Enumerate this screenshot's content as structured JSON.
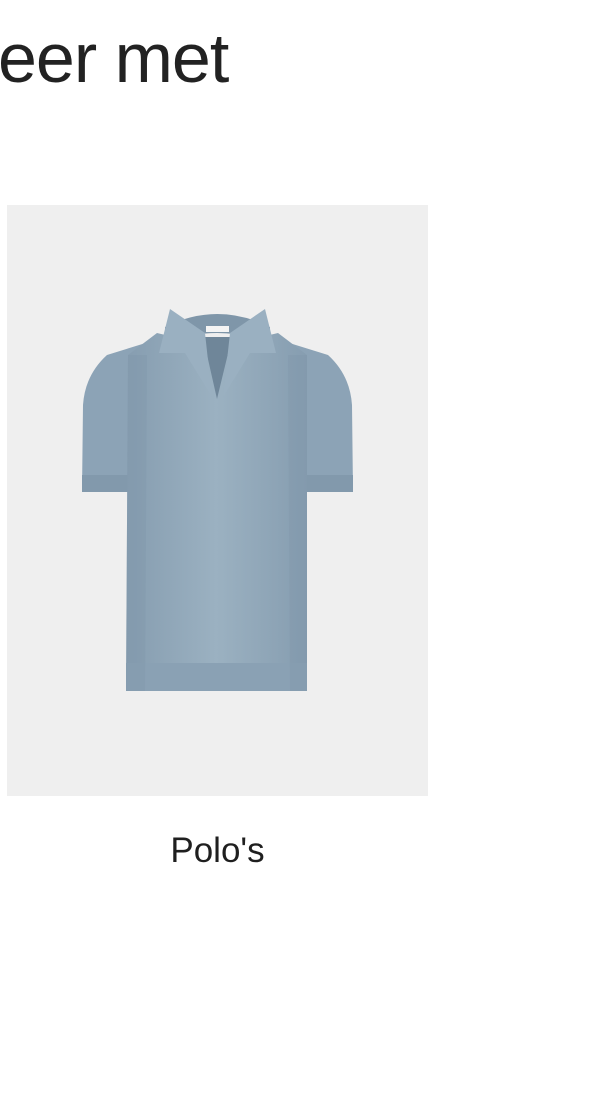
{
  "section": {
    "heading": "eer met"
  },
  "category_card": {
    "label": "Polo's",
    "image_icon": "polo-shirt-icon",
    "image_background": "#efefef",
    "garment_color": "#93a9ba"
  }
}
